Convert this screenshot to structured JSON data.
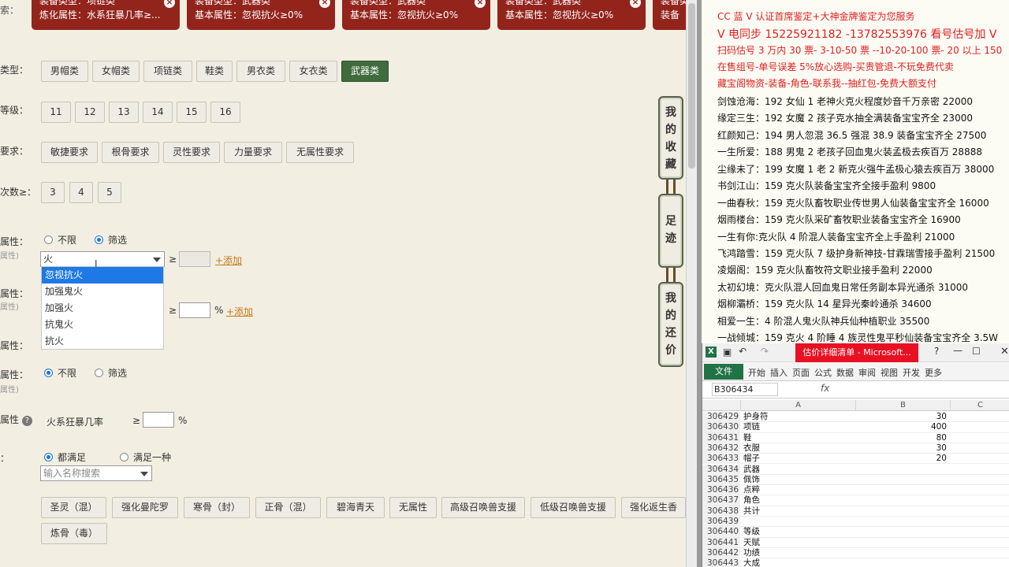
{
  "cards": [
    {
      "line1": "装备类型：项链类",
      "line2": "炼化属性：水系狂暴几率≥..."
    },
    {
      "line1": "装备类型：武器类",
      "line2": "基本属性：忽视抗火≥0%"
    },
    {
      "line1": "装备类型：武器类",
      "line2": "基本属性：忽视抗火≥0%"
    },
    {
      "line1": "装备类型：武器类",
      "line2": "基本属性：忽视抗火≥0%"
    },
    {
      "line1": "装备类",
      "line2": "装备"
    }
  ],
  "close_glyph": "×",
  "filters": {
    "search_label": "索：",
    "type_label": "类型：",
    "types": [
      "男帽类",
      "女帽类",
      "项链类",
      "鞋类",
      "男衣类",
      "女衣类",
      "武器类"
    ],
    "selected_type": "武器类",
    "level_label": "等级：",
    "levels": [
      "11",
      "12",
      "13",
      "14",
      "15",
      "16"
    ],
    "req_label": "要求：",
    "reqs": [
      "敏捷要求",
      "根骨要求",
      "灵性要求",
      "力量要求",
      "无属性要求"
    ],
    "count_label": "次数≥：",
    "counts": [
      "3",
      "4",
      "5"
    ],
    "attr1_label": "属性：",
    "attr1_sub": "属性)",
    "opt_unlimited": "不限",
    "opt_filter": "筛选",
    "combo_value": "火",
    "ge": "≥",
    "add_link": "+添加",
    "dropdown": [
      "忽视抗火",
      "加强鬼火",
      "加强火",
      "抗鬼火",
      "抗火"
    ],
    "attr2_label": "属性：",
    "attr2_sub": "属性)",
    "percent": "%",
    "attr3_label": "属性：",
    "attr4_label": "属性：",
    "attr4_sub": "属性)",
    "attr5_label": "属性",
    "attr5_name": "火系狂暴几率",
    "match_label": "：",
    "opt_all": "都满足",
    "opt_any": "满足一种",
    "name_search_placeholder": "输入名称搜索",
    "skills_row1": [
      "圣灵（混）",
      "强化曼陀罗",
      "寒骨（封）",
      "正骨（混）",
      "碧海青天",
      "无属性",
      "高级召唤兽支援",
      "低级召唤兽支援",
      "强化返生香"
    ],
    "skills_row2": [
      "炼骨（毒）"
    ]
  },
  "side_tabs": [
    {
      "chars": [
        "我",
        "的",
        "收",
        "藏"
      ]
    },
    {
      "chars": [
        "足",
        "迹"
      ]
    },
    {
      "chars": [
        "我",
        "的",
        "还",
        "价"
      ]
    }
  ],
  "notepad": {
    "lines": [
      {
        "text": "CC 蓝 V 认证首席鉴定+大神金牌鉴定为您服务",
        "style": "red"
      },
      {
        "text": "V 电同步 15225921182 -13782553976 看号估号加 V",
        "style": "red big"
      },
      {
        "text": "扫码估号 3 万内 30 票- 3-10-50 票 --10-20-100 票- 20 以上 150",
        "style": "red"
      },
      {
        "text": "在售组号-单号误差 5%放心选购-买贵管退-不玩免费代卖",
        "style": "red"
      },
      {
        "text": "藏宝阁物资-装备-角色-联系我--抽红包-免费大额支付",
        "style": "red"
      },
      {
        "text": "剑蚀沧海：192 女仙 1 老神火克火程度妙音千万亲密 22000",
        "style": ""
      },
      {
        "text": "缘定三生：192 女魔 2 孩子克水抽全满装备宝宝齐全 23000",
        "style": ""
      },
      {
        "text": "红颜知己：194 男人忽混 36.5 强混 38.9 装备宝宝齐全 27500",
        "style": ""
      },
      {
        "text": "一生所爱：188 男鬼 2 老孩子回血鬼火装孟极去疾百万 28888",
        "style": ""
      },
      {
        "text": "尘缘未了：199 女魔 1 老 2 新克火强牛孟极心猿去疾百万 38000",
        "style": ""
      },
      {
        "text": "书剑江山：159 克火队装备宝宝齐全接手盈利 9800",
        "style": ""
      },
      {
        "text": "一曲春秋：159 克火队畜牧职业传世男人仙装备宝宝齐全 16000",
        "style": ""
      },
      {
        "text": "烟雨楼台：159 克火队采矿畜牧职业装备宝宝齐全 16900",
        "style": ""
      },
      {
        "text": "一生有你:克火队 4 阶混人装备宝宝齐全上手盈利 21000",
        "style": ""
      },
      {
        "text": "飞鸿踏雪：159 克火队 7 级护身新神技-甘霖瑞雪接手盈利 21500",
        "style": ""
      },
      {
        "text": "凌烟阁：159 克火队畜牧符文职业接手盈利 22000",
        "style": ""
      },
      {
        "text": "太初幻境：克火队混人回血鬼日常任务副本异光通杀 31000",
        "style": ""
      },
      {
        "text": "烟柳灞桥：159 克火队 14 星异光秦岭通杀 34600",
        "style": ""
      },
      {
        "text": "相爱一生：4 阶混人鬼火队神兵仙种植职业 35500",
        "style": ""
      },
      {
        "text": "一战倾城：159 克火 4 阶睡 4 族灵性鬼平秒仙装备宝宝齐全 3.5W",
        "style": ""
      }
    ]
  },
  "excel": {
    "window_title": "估价详细清单 - Microsoft...",
    "file_tab": "文件",
    "ribbon_tabs": [
      "开始",
      "插入",
      "页面",
      "公式",
      "数据",
      "审阅",
      "视图",
      "开发",
      "更多"
    ],
    "cell_ref": "B306434",
    "fx": "fx",
    "col_headers": [
      "A",
      "B",
      "C"
    ],
    "rows": [
      {
        "n": "306429",
        "a": "护身符",
        "b": "30"
      },
      {
        "n": "306430",
        "a": "项链",
        "b": "400"
      },
      {
        "n": "306431",
        "a": "鞋",
        "b": "80"
      },
      {
        "n": "306432",
        "a": "衣服",
        "b": "30"
      },
      {
        "n": "306433",
        "a": "帽子",
        "b": "20"
      },
      {
        "n": "306434",
        "a": "武器",
        "b": ""
      },
      {
        "n": "306435",
        "a": "佩饰",
        "b": ""
      },
      {
        "n": "306436",
        "a": "点粹",
        "b": ""
      },
      {
        "n": "306437",
        "a": "角色",
        "b": ""
      },
      {
        "n": "306438",
        "a": "共计",
        "b": ""
      },
      {
        "n": "306439",
        "a": "",
        "b": ""
      },
      {
        "n": "306440",
        "a": "等级",
        "b": ""
      },
      {
        "n": "306441",
        "a": "天赋",
        "b": ""
      },
      {
        "n": "306442",
        "a": "功绩",
        "b": ""
      },
      {
        "n": "306443",
        "a": "大成",
        "b": ""
      }
    ]
  }
}
